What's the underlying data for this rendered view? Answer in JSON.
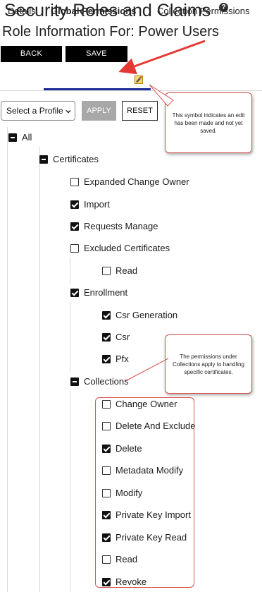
{
  "header": {
    "title": "Security Roles and Claims",
    "subtitle": "Role Information For: Power Users",
    "help_icon": "?"
  },
  "toolbar": {
    "back_label": "BACK",
    "save_label": "SAVE"
  },
  "tabs": [
    {
      "label": "Details"
    },
    {
      "label": "Global Permissions",
      "active": true
    },
    {
      "label": "Collection Permissions"
    }
  ],
  "profile": {
    "selected": "Select a Profile",
    "apply_label": "APPLY",
    "reset_label": "RESET"
  },
  "tree": {
    "all": {
      "label": "All",
      "state": "partial"
    },
    "certificates": {
      "label": "Certificates",
      "state": "partial"
    },
    "expanded_change_owner": {
      "label": "Expanded Change Owner",
      "state": "unchecked"
    },
    "import": {
      "label": "Import",
      "state": "checked"
    },
    "requests_manage": {
      "label": "Requests Manage",
      "state": "checked"
    },
    "excluded_certificates": {
      "label": "Excluded Certificates",
      "state": "unchecked"
    },
    "excluded_read": {
      "label": "Read",
      "state": "unchecked"
    },
    "enrollment": {
      "label": "Enrollment",
      "state": "checked"
    },
    "csr_generation": {
      "label": "Csr Generation",
      "state": "checked"
    },
    "csr": {
      "label": "Csr",
      "state": "checked"
    },
    "pfx": {
      "label": "Pfx",
      "state": "checked"
    },
    "collections": {
      "label": "Collections",
      "state": "partial"
    },
    "change_owner": {
      "label": "Change Owner",
      "state": "unchecked"
    },
    "delete_and_exclude": {
      "label": "Delete And Exclude",
      "state": "unchecked"
    },
    "delete": {
      "label": "Delete",
      "state": "checked"
    },
    "metadata_modify": {
      "label": "Metadata Modify",
      "state": "unchecked"
    },
    "modify": {
      "label": "Modify",
      "state": "unchecked"
    },
    "private_key_import": {
      "label": "Private Key Import",
      "state": "checked"
    },
    "private_key_read": {
      "label": "Private Key Read",
      "state": "checked"
    },
    "collections_read": {
      "label": "Read",
      "state": "unchecked"
    },
    "revoke": {
      "label": "Revoke",
      "state": "checked"
    }
  },
  "callouts": {
    "edit_symbol": "This symbol indicates an edit has been made and not yet saved.",
    "collections_note": "The permissions under Collections apply to handling specific certificates."
  },
  "colors": {
    "accent": "#1f2a9c",
    "annotation": "#d9534f",
    "pending_icon": "#e0b020"
  }
}
